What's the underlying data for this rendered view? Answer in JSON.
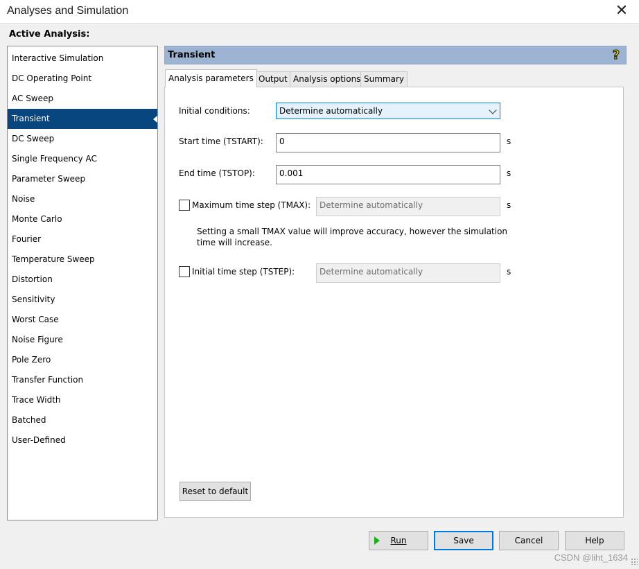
{
  "window": {
    "title": "Analyses and Simulation",
    "close_glyph": "✕"
  },
  "active_analysis_label": "Active Analysis:",
  "analyses": [
    "Interactive Simulation",
    "DC Operating Point",
    "AC Sweep",
    "Transient",
    "DC Sweep",
    "Single Frequency AC",
    "Parameter Sweep",
    "Noise",
    "Monte Carlo",
    "Fourier",
    "Temperature Sweep",
    "Distortion",
    "Sensitivity",
    "Worst Case",
    "Noise Figure",
    "Pole Zero",
    "Transfer Function",
    "Trace Width",
    "Batched",
    "User-Defined"
  ],
  "selected_analysis": "Transient",
  "header": {
    "title": "Transient",
    "help_glyph": "?"
  },
  "tabs": [
    "Analysis parameters",
    "Output",
    "Analysis options",
    "Summary"
  ],
  "form": {
    "initial_conditions_label": "Initial conditions:",
    "initial_conditions_value": "Determine automatically",
    "start_time_label": "Start time (TSTART):",
    "start_time_value": "0",
    "end_time_label": "End time (TSTOP):",
    "end_time_value": "0.001",
    "unit": "s",
    "tmax_label": "Maximum time step (TMAX):",
    "tmax_value": "Determine automatically",
    "tmax_note_line1": "Setting a small TMAX value will improve accuracy, however the simulation",
    "tmax_note_line2": "time will increase.",
    "tstep_label": "Initial time step (TSTEP):",
    "tstep_value": "Determine automatically"
  },
  "buttons": {
    "reset": "Reset to default",
    "run": "Run",
    "save": "Save",
    "cancel": "Cancel",
    "help": "Help"
  },
  "watermark": "CSDN @liht_1634",
  "colors": {
    "selection": "#08467f",
    "header": "#9cb3d1",
    "focus": "#0078d7"
  }
}
